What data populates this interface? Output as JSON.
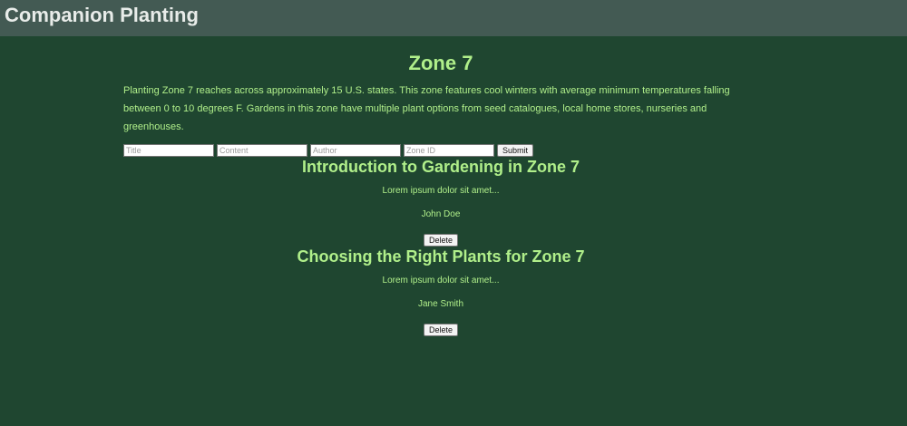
{
  "header": {
    "title": "Companion Planting"
  },
  "zone": {
    "title": "Zone 7",
    "description": "Planting Zone 7 reaches across approximately 15 U.S. states. This zone features cool winters with average minimum temperatures falling between 0 to 10 degrees F. Gardens in this zone have multiple plant options from seed catalogues, local home stores, nurseries and greenhouses."
  },
  "form": {
    "title_placeholder": "Title",
    "content_placeholder": "Content",
    "author_placeholder": "Author",
    "zone_id_placeholder": "Zone ID",
    "submit_label": "Submit"
  },
  "articles": [
    {
      "title": "Introduction to Gardening in Zone 7",
      "content": "Lorem ipsum dolor sit amet...",
      "author": "John Doe",
      "delete_label": "Delete"
    },
    {
      "title": "Choosing the Right Plants for Zone 7",
      "content": "Lorem ipsum dolor sit amet...",
      "author": "Jane Smith",
      "delete_label": "Delete"
    }
  ],
  "colors": {
    "background": "#1f4630",
    "header_bar": "#435a53",
    "accent_text": "#b0ef8a"
  }
}
